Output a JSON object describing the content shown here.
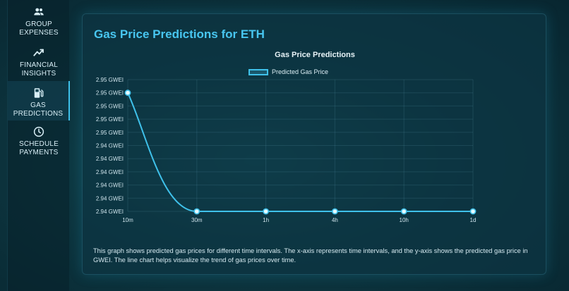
{
  "sidebar": {
    "items": [
      {
        "label": "GROUP\nEXPENSES",
        "icon": "group-icon",
        "active": false
      },
      {
        "label": "FINANCIAL\nINSIGHTS",
        "icon": "trend-icon",
        "active": false
      },
      {
        "label": "GAS\nPREDICTIONS",
        "icon": "gas-pump-icon",
        "active": true
      },
      {
        "label": "SCHEDULE\nPAYMENTS",
        "icon": "clock-icon",
        "active": false
      }
    ]
  },
  "main": {
    "title": "Gas Price Predictions for ETH",
    "description": "This graph shows predicted gas prices for different time intervals. The x-axis represents time intervals, and the y-axis shows the predicted gas price in GWEI. The line chart helps visualize the trend of gas prices over time."
  },
  "colors": {
    "accent": "#3fc1ea",
    "title": "#48c6f0"
  },
  "chart_data": {
    "type": "line",
    "title": "Gas Price Predictions",
    "categories": [
      "10m",
      "30m",
      "1h",
      "4h",
      "10h",
      "1d"
    ],
    "series": [
      {
        "name": "Predicted Gas Price",
        "values": [
          2.954,
          2.936,
          2.936,
          2.936,
          2.936,
          2.936
        ]
      }
    ],
    "y_tick_labels": [
      "2.95 GWEI",
      "2.95 GWEI",
      "2.95 GWEI",
      "2.95 GWEI",
      "2.95 GWEI",
      "2.94 GWEI",
      "2.94 GWEI",
      "2.94 GWEI",
      "2.94 GWEI",
      "2.94 GWEI",
      "2.94 GWEI"
    ],
    "ylim": [
      2.936,
      2.956
    ],
    "xlabel": "",
    "ylabel": "",
    "legend": "top",
    "grid": true
  }
}
